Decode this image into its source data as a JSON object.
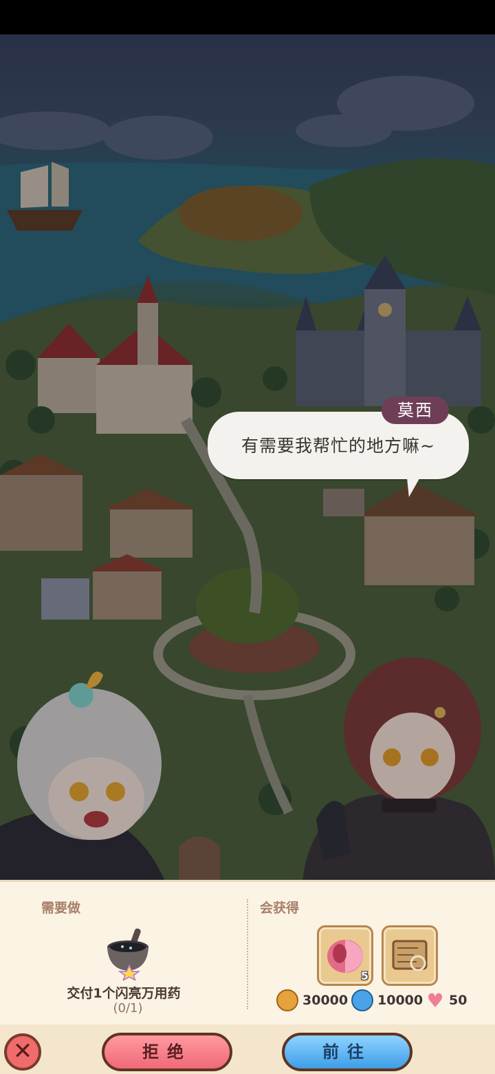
{
  "dialog": {
    "speaker": "莫西",
    "text": "有需要我帮忙的地方嘛~"
  },
  "quest": {
    "need_label": "需要做",
    "reward_label": "会获得",
    "task_text": "交付1个闪亮万用药",
    "task_progress": "(0/1)",
    "rewards": [
      {
        "icon": "cake-item-icon",
        "count": "5"
      },
      {
        "icon": "scroll-map-item-icon",
        "count": ""
      }
    ],
    "resources": [
      {
        "icon": "gold-coin-icon",
        "value": "30000",
        "color": "#e6a23c"
      },
      {
        "icon": "blue-potion-icon",
        "value": "10000",
        "color": "#4aa3e8"
      },
      {
        "icon": "heart-icon",
        "value": "50",
        "color": "#ef7f95"
      }
    ]
  },
  "buttons": {
    "close": "✕",
    "reject": "拒绝",
    "go": "前往"
  }
}
